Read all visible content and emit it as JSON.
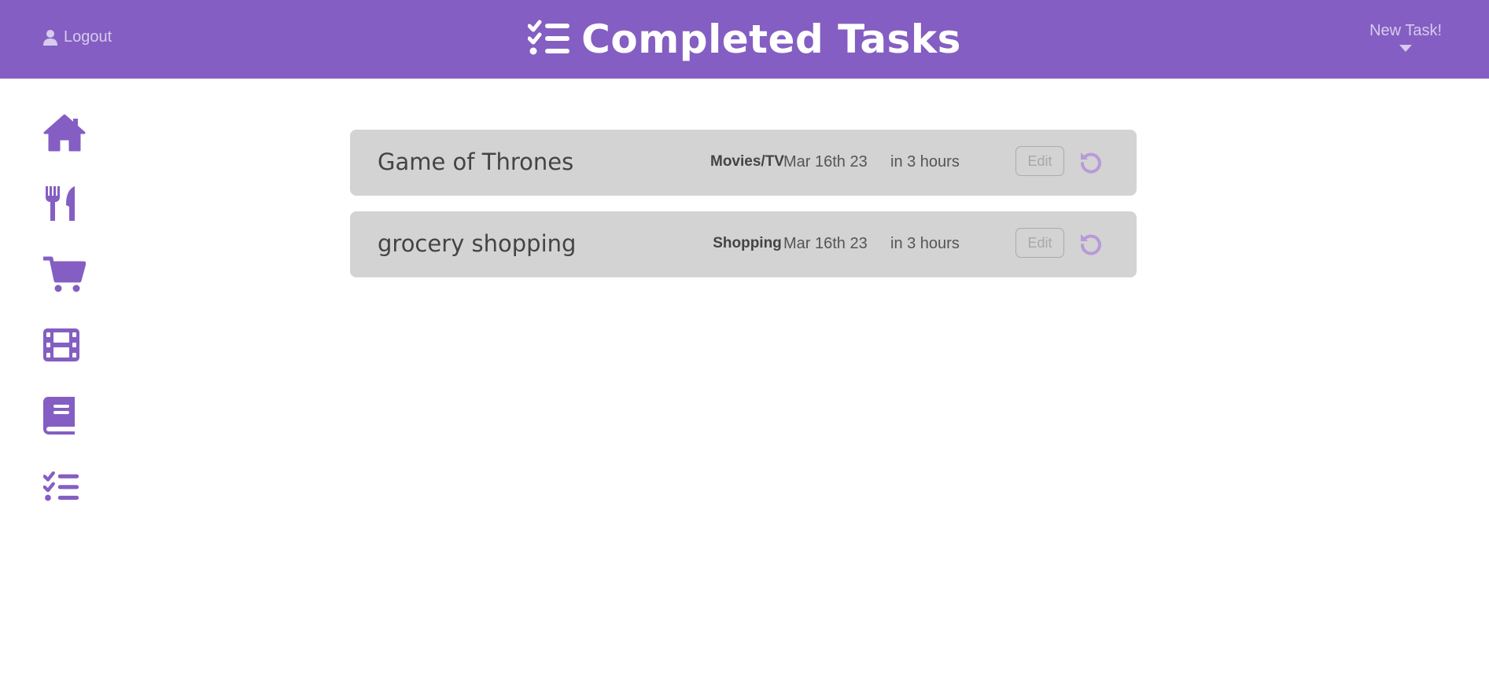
{
  "header": {
    "logout_label": "Logout",
    "title": "Completed Tasks",
    "new_task_label": "New Task!"
  },
  "colors": {
    "header_bg": "#845ec2",
    "accent": "#845ec2",
    "row_bg": "#d3d3d3",
    "undo_icon": "#b89ad9"
  },
  "sidebar": {
    "items": [
      {
        "icon": "home-icon"
      },
      {
        "icon": "fork-knife-icon"
      },
      {
        "icon": "shopping-cart-icon"
      },
      {
        "icon": "film-icon"
      },
      {
        "icon": "book-icon"
      },
      {
        "icon": "list-check-icon"
      }
    ]
  },
  "tasks": [
    {
      "name": "Game of Thrones",
      "category": "Movies/TV",
      "date": "Mar 16th 23",
      "relative": "in 3 hours",
      "edit_label": "Edit"
    },
    {
      "name": "grocery shopping",
      "category": "Shopping",
      "date": "Mar 16th 23",
      "relative": "in 3 hours",
      "edit_label": "Edit"
    }
  ]
}
